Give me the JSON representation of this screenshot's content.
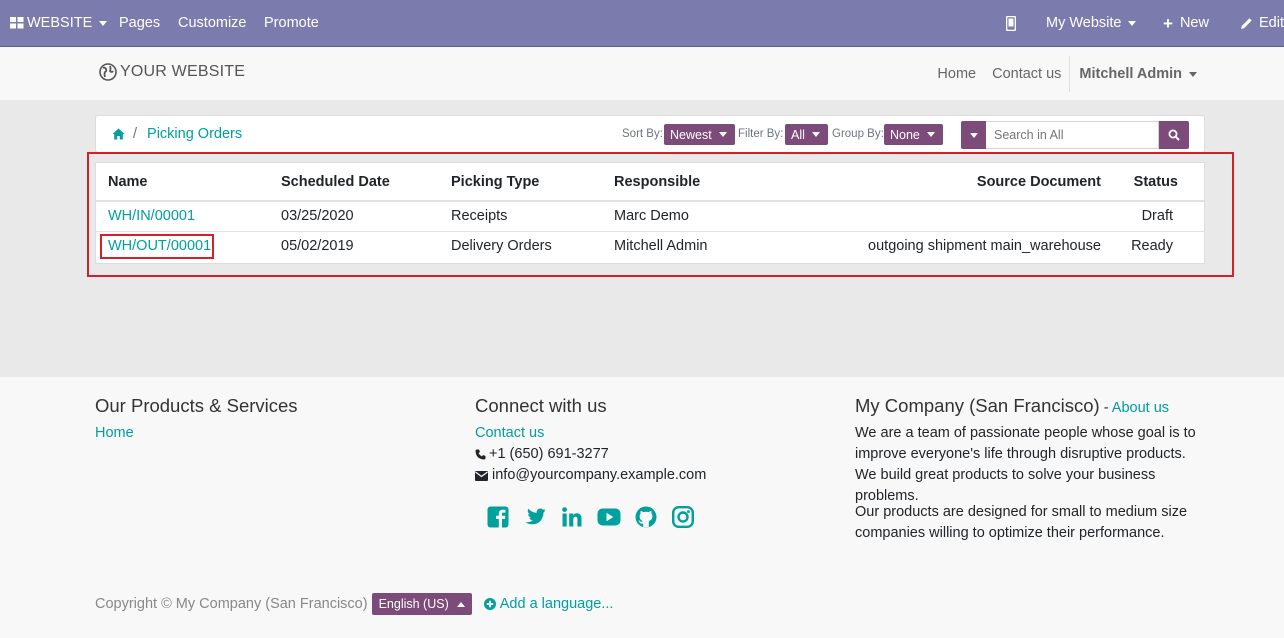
{
  "topbar": {
    "website": "WEBSITE",
    "pages": "Pages",
    "customize": "Customize",
    "promote": "Promote",
    "my_website": "My Website",
    "new": "New",
    "edit": "Edit"
  },
  "header": {
    "logo": "YOUR WEBSITE",
    "nav": [
      "Home",
      "Contact us"
    ],
    "user": "Mitchell Admin"
  },
  "controls": {
    "breadcrumb": "Picking Orders",
    "sort_label": "Sort By:",
    "sort_value": "Newest",
    "filter_label": "Filter By:",
    "filter_value": "All",
    "group_label": "Group By:",
    "group_value": "None",
    "search_placeholder": "Search in All"
  },
  "table": {
    "headers": [
      "Name",
      "Scheduled Date",
      "Picking Type",
      "Responsible",
      "Source Document",
      "Status"
    ],
    "rows": [
      {
        "name": "WH/IN/00001",
        "date": "03/25/2020",
        "type": "Receipts",
        "responsible": "Marc Demo",
        "source": "",
        "status": "Draft"
      },
      {
        "name": "WH/OUT/00001",
        "date": "05/02/2019",
        "type": "Delivery Orders",
        "responsible": "Mitchell Admin",
        "source": "outgoing shipment main_warehouse",
        "status": "Ready"
      }
    ]
  },
  "footer": {
    "col1_title": "Our Products & Services",
    "col1_link": "Home",
    "col2_title": "Connect with us",
    "col2_link": "Contact us",
    "phone": "+1 (650) 691-3277",
    "email": "info@yourcompany.example.com",
    "col3_title": "My Company (San Francisco)",
    "col3_dash": " - ",
    "col3_link": "About us",
    "para1": "We are a team of passionate people whose goal is to improve everyone's life through disruptive products. We build great products to solve your business problems.",
    "para2": "Our products are designed for small to medium size companies willing to optimize their performance.",
    "copyright": "Copyright © My Company (San Francisco)",
    "language": "English (US)",
    "add_language": "Add a language...",
    "social_icons": [
      "facebook-icon",
      "twitter-icon",
      "linkedin-icon",
      "youtube-icon",
      "github-icon",
      "instagram-icon"
    ]
  },
  "colors": {
    "topbar": "#7c7bad",
    "accent": "#00a09d",
    "button": "#7c4b7a",
    "highlight": "#d3202a"
  }
}
